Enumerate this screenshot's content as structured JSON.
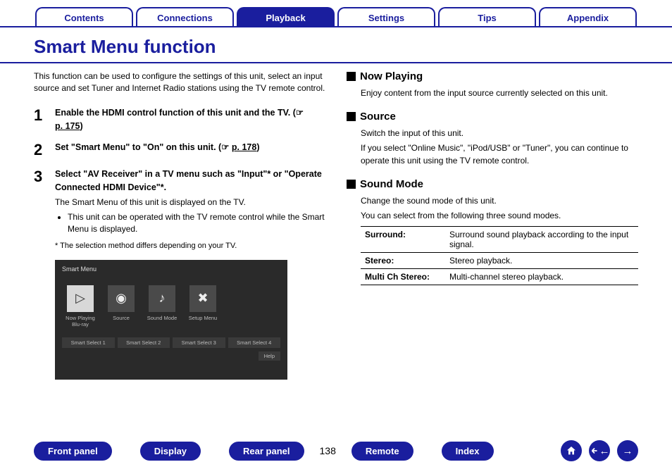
{
  "tabs": {
    "contents": "Contents",
    "connections": "Connections",
    "playback": "Playback",
    "settings": "Settings",
    "tips": "Tips",
    "appendix": "Appendix"
  },
  "title": "Smart Menu function",
  "intro": "This function can be used to configure the settings of this unit, select an input source and set Tuner and Internet Radio stations using the TV remote control.",
  "steps": {
    "s1": {
      "num": "1",
      "bold_a": "Enable the HDMI control function of this unit and the TV.  (",
      "ref": "p. 175",
      "bold_b": ")"
    },
    "s2": {
      "num": "2",
      "bold_a": "Set \"Smart Menu\" to \"On\" on this unit.  (",
      "ref": "p. 178",
      "bold_b": ")"
    },
    "s3": {
      "num": "3",
      "bold": "Select \"AV Receiver\" in a TV menu such as \"Input\"* or \"Operate Connected HDMI Device\"*.",
      "plain": "The Smart Menu of this unit is displayed on the TV.",
      "bullet": "This unit can be operated with the TV remote control while the Smart Menu is displayed.",
      "footnote": "* The selection method differs depending on your TV."
    }
  },
  "smartmenu": {
    "title": "Smart Menu",
    "icons": {
      "now": "Now Playing\nBlu-ray",
      "source": "Source",
      "sound": "Sound Mode",
      "setup": "Setup Menu"
    },
    "selects": {
      "s1": "Smart Select 1",
      "s2": "Smart Select 2",
      "s3": "Smart Select 3",
      "s4": "Smart Select 4"
    },
    "help": "Help"
  },
  "right": {
    "nowplaying": {
      "h": "Now Playing",
      "p1": "Enjoy content from the input source currently selected on this unit."
    },
    "source": {
      "h": "Source",
      "p1": "Switch the input of this unit.",
      "p2": "If you select \"Online Music\", \"iPod/USB\" or \"Tuner\", you can continue to operate this unit using the TV remote control."
    },
    "soundmode": {
      "h": "Sound Mode",
      "p1": "Change the sound mode of this unit.",
      "p2": "You can select from the following three sound modes.",
      "table": {
        "r1k": "Surround:",
        "r1v": "Surround sound playback according to the input signal.",
        "r2k": "Stereo:",
        "r2v": "Stereo playback.",
        "r3k": "Multi Ch Stereo:",
        "r3v": "Multi-channel stereo playback."
      }
    }
  },
  "bottom": {
    "front": "Front panel",
    "display": "Display",
    "rear": "Rear panel",
    "page": "138",
    "remote": "Remote",
    "index": "Index"
  }
}
